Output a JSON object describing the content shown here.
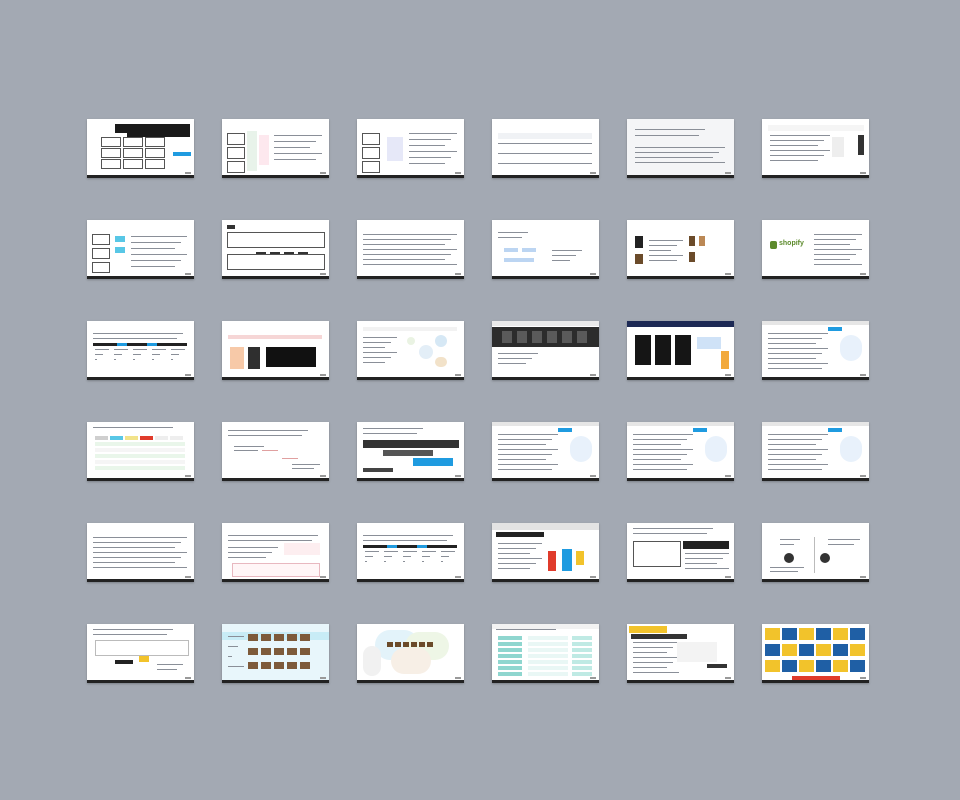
{
  "overview": {
    "title": "",
    "slide_count": 36
  },
  "colors": {
    "background": "#a3a9b3",
    "slide": "#ffffff",
    "accent_blue": "#1f9be0",
    "accent_cyan": "#58c7e6",
    "accent_red": "#e03b2b",
    "accent_yellow": "#f2c32b",
    "accent_green": "#5c8a2b",
    "dark": "#111111"
  },
  "slides": [
    {
      "n": 1,
      "style": "dark-boxes"
    },
    {
      "n": 2,
      "style": "diagram-flow"
    },
    {
      "n": 3,
      "style": "diagram-left"
    },
    {
      "n": 4,
      "style": "table"
    },
    {
      "n": 5,
      "style": "text-light"
    },
    {
      "n": 6,
      "style": "web-capture"
    },
    {
      "n": 7,
      "style": "process-cyan"
    },
    {
      "n": 8,
      "style": "wide-flow"
    },
    {
      "n": 9,
      "style": "text"
    },
    {
      "n": 10,
      "style": "mini-chart"
    },
    {
      "n": 11,
      "style": "photos"
    },
    {
      "n": 12,
      "style": "shopify-logo",
      "label": "shopify"
    },
    {
      "n": 13,
      "style": "timeline"
    },
    {
      "n": 14,
      "style": "diagram-photo"
    },
    {
      "n": 15,
      "style": "network"
    },
    {
      "n": 16,
      "style": "dark-banner"
    },
    {
      "n": 17,
      "style": "dark-cards"
    },
    {
      "n": 18,
      "style": "text-pie"
    },
    {
      "n": 19,
      "style": "color-table"
    },
    {
      "n": 20,
      "style": "step-lines"
    },
    {
      "n": 21,
      "style": "gantt"
    },
    {
      "n": 22,
      "style": "text-pie"
    },
    {
      "n": 23,
      "style": "text-pie"
    },
    {
      "n": 24,
      "style": "text-pie"
    },
    {
      "n": 25,
      "style": "text"
    },
    {
      "n": 26,
      "style": "text-pink"
    },
    {
      "n": 27,
      "style": "timeline"
    },
    {
      "n": 28,
      "style": "product"
    },
    {
      "n": 29,
      "style": "checklist"
    },
    {
      "n": 30,
      "style": "icons-two"
    },
    {
      "n": 31,
      "style": "sketch"
    },
    {
      "n": 32,
      "style": "photo-grid"
    },
    {
      "n": 33,
      "style": "venn"
    },
    {
      "n": 34,
      "style": "teal-table"
    },
    {
      "n": 35,
      "style": "yellow-dark"
    },
    {
      "n": 36,
      "style": "color-blocks"
    }
  ]
}
